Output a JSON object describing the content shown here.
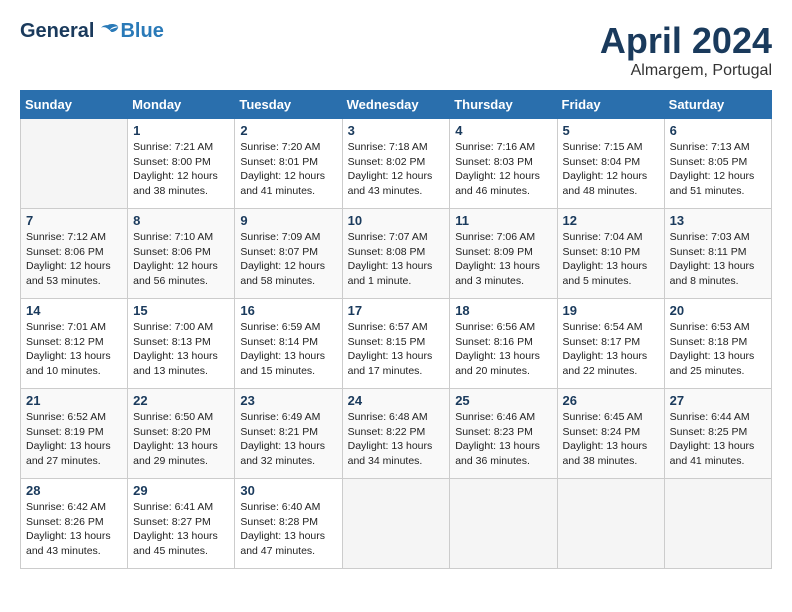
{
  "header": {
    "logo_general": "General",
    "logo_blue": "Blue",
    "title": "April 2024",
    "subtitle": "Almargem, Portugal"
  },
  "days_of_week": [
    "Sunday",
    "Monday",
    "Tuesday",
    "Wednesday",
    "Thursday",
    "Friday",
    "Saturday"
  ],
  "weeks": [
    [
      {
        "day": "",
        "sunrise": "",
        "sunset": "",
        "daylight": ""
      },
      {
        "day": "1",
        "sunrise": "Sunrise: 7:21 AM",
        "sunset": "Sunset: 8:00 PM",
        "daylight": "Daylight: 12 hours and 38 minutes."
      },
      {
        "day": "2",
        "sunrise": "Sunrise: 7:20 AM",
        "sunset": "Sunset: 8:01 PM",
        "daylight": "Daylight: 12 hours and 41 minutes."
      },
      {
        "day": "3",
        "sunrise": "Sunrise: 7:18 AM",
        "sunset": "Sunset: 8:02 PM",
        "daylight": "Daylight: 12 hours and 43 minutes."
      },
      {
        "day": "4",
        "sunrise": "Sunrise: 7:16 AM",
        "sunset": "Sunset: 8:03 PM",
        "daylight": "Daylight: 12 hours and 46 minutes."
      },
      {
        "day": "5",
        "sunrise": "Sunrise: 7:15 AM",
        "sunset": "Sunset: 8:04 PM",
        "daylight": "Daylight: 12 hours and 48 minutes."
      },
      {
        "day": "6",
        "sunrise": "Sunrise: 7:13 AM",
        "sunset": "Sunset: 8:05 PM",
        "daylight": "Daylight: 12 hours and 51 minutes."
      }
    ],
    [
      {
        "day": "7",
        "sunrise": "Sunrise: 7:12 AM",
        "sunset": "Sunset: 8:06 PM",
        "daylight": "Daylight: 12 hours and 53 minutes."
      },
      {
        "day": "8",
        "sunrise": "Sunrise: 7:10 AM",
        "sunset": "Sunset: 8:06 PM",
        "daylight": "Daylight: 12 hours and 56 minutes."
      },
      {
        "day": "9",
        "sunrise": "Sunrise: 7:09 AM",
        "sunset": "Sunset: 8:07 PM",
        "daylight": "Daylight: 12 hours and 58 minutes."
      },
      {
        "day": "10",
        "sunrise": "Sunrise: 7:07 AM",
        "sunset": "Sunset: 8:08 PM",
        "daylight": "Daylight: 13 hours and 1 minute."
      },
      {
        "day": "11",
        "sunrise": "Sunrise: 7:06 AM",
        "sunset": "Sunset: 8:09 PM",
        "daylight": "Daylight: 13 hours and 3 minutes."
      },
      {
        "day": "12",
        "sunrise": "Sunrise: 7:04 AM",
        "sunset": "Sunset: 8:10 PM",
        "daylight": "Daylight: 13 hours and 5 minutes."
      },
      {
        "day": "13",
        "sunrise": "Sunrise: 7:03 AM",
        "sunset": "Sunset: 8:11 PM",
        "daylight": "Daylight: 13 hours and 8 minutes."
      }
    ],
    [
      {
        "day": "14",
        "sunrise": "Sunrise: 7:01 AM",
        "sunset": "Sunset: 8:12 PM",
        "daylight": "Daylight: 13 hours and 10 minutes."
      },
      {
        "day": "15",
        "sunrise": "Sunrise: 7:00 AM",
        "sunset": "Sunset: 8:13 PM",
        "daylight": "Daylight: 13 hours and 13 minutes."
      },
      {
        "day": "16",
        "sunrise": "Sunrise: 6:59 AM",
        "sunset": "Sunset: 8:14 PM",
        "daylight": "Daylight: 13 hours and 15 minutes."
      },
      {
        "day": "17",
        "sunrise": "Sunrise: 6:57 AM",
        "sunset": "Sunset: 8:15 PM",
        "daylight": "Daylight: 13 hours and 17 minutes."
      },
      {
        "day": "18",
        "sunrise": "Sunrise: 6:56 AM",
        "sunset": "Sunset: 8:16 PM",
        "daylight": "Daylight: 13 hours and 20 minutes."
      },
      {
        "day": "19",
        "sunrise": "Sunrise: 6:54 AM",
        "sunset": "Sunset: 8:17 PM",
        "daylight": "Daylight: 13 hours and 22 minutes."
      },
      {
        "day": "20",
        "sunrise": "Sunrise: 6:53 AM",
        "sunset": "Sunset: 8:18 PM",
        "daylight": "Daylight: 13 hours and 25 minutes."
      }
    ],
    [
      {
        "day": "21",
        "sunrise": "Sunrise: 6:52 AM",
        "sunset": "Sunset: 8:19 PM",
        "daylight": "Daylight: 13 hours and 27 minutes."
      },
      {
        "day": "22",
        "sunrise": "Sunrise: 6:50 AM",
        "sunset": "Sunset: 8:20 PM",
        "daylight": "Daylight: 13 hours and 29 minutes."
      },
      {
        "day": "23",
        "sunrise": "Sunrise: 6:49 AM",
        "sunset": "Sunset: 8:21 PM",
        "daylight": "Daylight: 13 hours and 32 minutes."
      },
      {
        "day": "24",
        "sunrise": "Sunrise: 6:48 AM",
        "sunset": "Sunset: 8:22 PM",
        "daylight": "Daylight: 13 hours and 34 minutes."
      },
      {
        "day": "25",
        "sunrise": "Sunrise: 6:46 AM",
        "sunset": "Sunset: 8:23 PM",
        "daylight": "Daylight: 13 hours and 36 minutes."
      },
      {
        "day": "26",
        "sunrise": "Sunrise: 6:45 AM",
        "sunset": "Sunset: 8:24 PM",
        "daylight": "Daylight: 13 hours and 38 minutes."
      },
      {
        "day": "27",
        "sunrise": "Sunrise: 6:44 AM",
        "sunset": "Sunset: 8:25 PM",
        "daylight": "Daylight: 13 hours and 41 minutes."
      }
    ],
    [
      {
        "day": "28",
        "sunrise": "Sunrise: 6:42 AM",
        "sunset": "Sunset: 8:26 PM",
        "daylight": "Daylight: 13 hours and 43 minutes."
      },
      {
        "day": "29",
        "sunrise": "Sunrise: 6:41 AM",
        "sunset": "Sunset: 8:27 PM",
        "daylight": "Daylight: 13 hours and 45 minutes."
      },
      {
        "day": "30",
        "sunrise": "Sunrise: 6:40 AM",
        "sunset": "Sunset: 8:28 PM",
        "daylight": "Daylight: 13 hours and 47 minutes."
      },
      {
        "day": "",
        "sunrise": "",
        "sunset": "",
        "daylight": ""
      },
      {
        "day": "",
        "sunrise": "",
        "sunset": "",
        "daylight": ""
      },
      {
        "day": "",
        "sunrise": "",
        "sunset": "",
        "daylight": ""
      },
      {
        "day": "",
        "sunrise": "",
        "sunset": "",
        "daylight": ""
      }
    ]
  ]
}
